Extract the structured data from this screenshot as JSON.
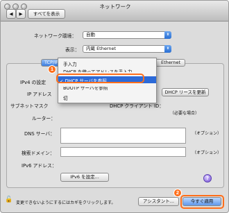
{
  "window": {
    "title": "ネットワーク",
    "toolbar": {
      "back": "◀",
      "forward": "▶",
      "show_all": "すべてを表示"
    }
  },
  "network_env": {
    "label": "ネットワーク環境：",
    "value": "自動"
  },
  "show": {
    "label": "表示：",
    "value": "内蔵 Ethernet"
  },
  "tabs": [
    "TCP/IP",
    "Ethernet"
  ],
  "form": {
    "ipv4_label": "IPv4 の設定",
    "ip_label": "IP アドレス",
    "subnet_label": "サブネットマスク",
    "router_label": "ルーター：",
    "dhcp_renew": "DHCP リースを更新",
    "dhcp_client_id_label": "DHCP クライアント ID：",
    "required_note": "（必要な場合）",
    "dns_label": "DNS サーバ：",
    "dns_optional": "（オプション）",
    "search_domain_label": "検索ドメイン：",
    "search_optional": "（オプション）",
    "ipv6_label": "IPv6 アドレス：",
    "ipv6_button": "IPv6 を設定...",
    "help": "?"
  },
  "menu": {
    "items": [
      "手入力",
      "DHCP を使ってアドレスを手入力",
      "DHCP サーバを参照",
      "BOOTP サーバを参照",
      "切"
    ],
    "selected_index": 2,
    "check": "✓"
  },
  "footer": {
    "lock_text": "変更できないようにするにはカギをクリックします。",
    "assistant": "アシスタント...",
    "apply_now": "今すぐ適用"
  },
  "annotations": {
    "badge1": "1",
    "badge2": "2"
  },
  "colors": {
    "highlight": "#2c6ad8",
    "annotation": "#ff6e1a"
  }
}
